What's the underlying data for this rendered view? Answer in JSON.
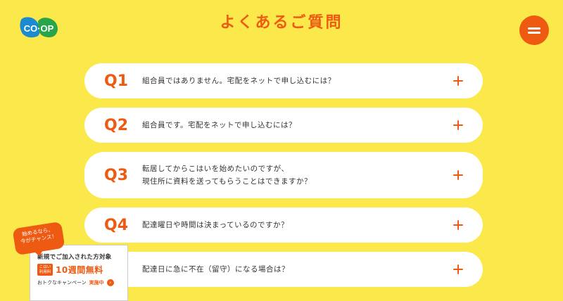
{
  "header": {
    "logo_text": "CO·OP",
    "title": "よくあるご質問",
    "colors": {
      "accent": "#ee5a12",
      "background": "#fbe84a"
    }
  },
  "faq": [
    {
      "num": "Q1",
      "text": "組合員ではありません。宅配をネットで申し込むには？"
    },
    {
      "num": "Q2",
      "text": "組合員です。宅配をネットで申し込むには？"
    },
    {
      "num": "Q3",
      "text_line1": "転居してからこはいを始めたいのですが、",
      "text_line2": "現住所に資料を送ってもらうことはできますか？"
    },
    {
      "num": "Q4",
      "text": "配達曜日や時間は決まっているのですか？"
    },
    {
      "num": "",
      "text": "配達日に急に不在（留守）になる場合は？"
    }
  ],
  "promo": {
    "badge_line1": "始めるなら、",
    "badge_line2": "今がチャンス！",
    "line1": "新規でご加入された方対象",
    "tag_line1": "こはい",
    "tag_line2": "利用料",
    "free": "10週間無料",
    "campaign": "おトクなキャンペーン",
    "now": "実施中"
  }
}
